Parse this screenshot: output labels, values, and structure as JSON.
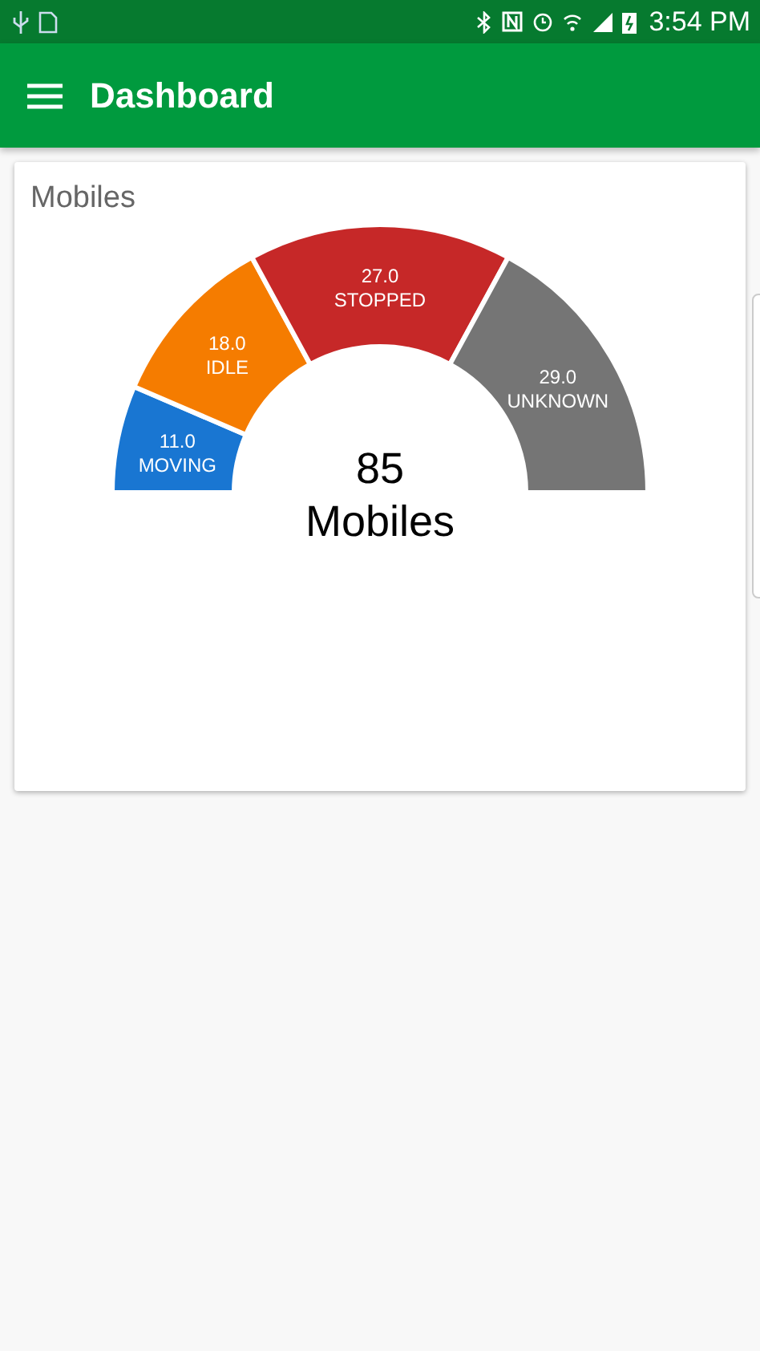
{
  "status_bar": {
    "time": "3:54 PM"
  },
  "app_bar": {
    "title": "Dashboard"
  },
  "card": {
    "title": "Mobiles",
    "chart_data": {
      "type": "donut",
      "categories": [
        "MOVING",
        "IDLE",
        "STOPPED",
        "UNKNOWN"
      ],
      "values": [
        11,
        18,
        27,
        29
      ],
      "colors": [
        "#1976d2",
        "#f57c00",
        "#c62828",
        "#757575"
      ],
      "data_labels": true,
      "value_labels": [
        "11.0",
        "18.0",
        "27.0",
        "29.0"
      ]
    },
    "center_value": "85",
    "center_label": "Mobiles"
  }
}
